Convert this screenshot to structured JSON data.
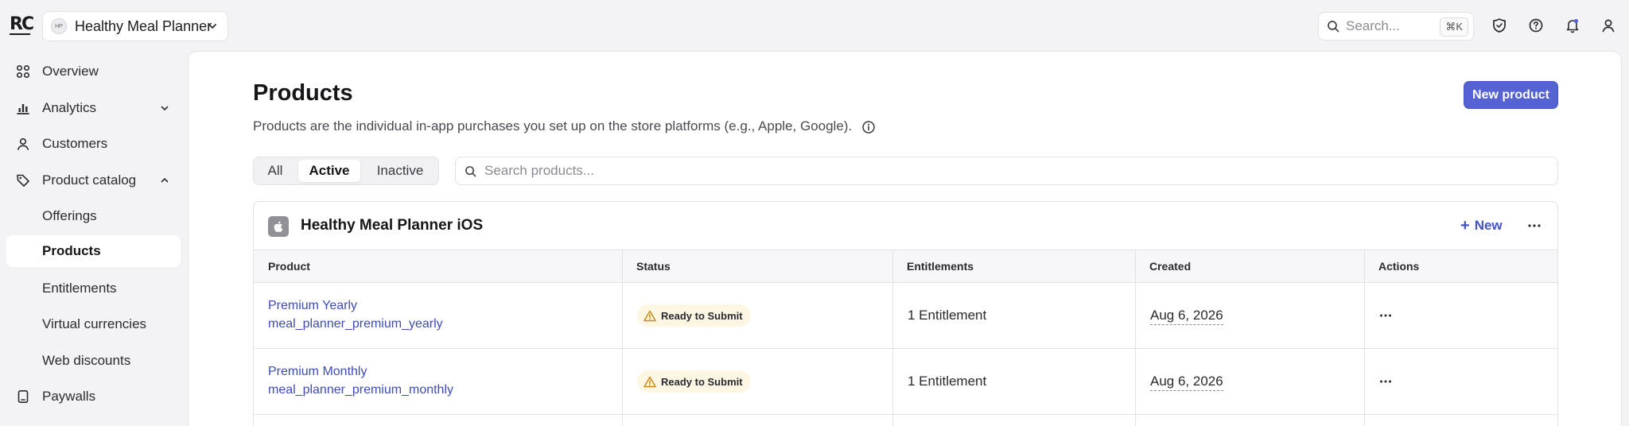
{
  "topbar": {
    "logo_text": "RC",
    "project_initials": "HP",
    "project_name": "Healthy Meal Planner",
    "search_placeholder": "Search...",
    "search_shortcut": "⌘K"
  },
  "sidebar": {
    "items": [
      {
        "label": "Overview",
        "icon": "grid-icon"
      },
      {
        "label": "Analytics",
        "icon": "bar-chart-icon",
        "expandable": true,
        "expanded": false
      },
      {
        "label": "Customers",
        "icon": "person-icon"
      },
      {
        "label": "Product catalog",
        "icon": "tag-icon",
        "expandable": true,
        "expanded": true
      },
      {
        "label": "Offerings"
      },
      {
        "label": "Products",
        "active": true
      },
      {
        "label": "Entitlements"
      },
      {
        "label": "Virtual currencies"
      },
      {
        "label": "Web discounts"
      },
      {
        "label": "Paywalls",
        "icon": "paywall-icon"
      }
    ]
  },
  "main": {
    "title": "Products",
    "description": "Products are the individual in-app purchases you set up on the store platforms (e.g., Apple, Google).",
    "new_product_label": "New product",
    "filter_tabs": [
      "All",
      "Active",
      "Inactive"
    ],
    "active_tab": "Active",
    "search_placeholder": "Search products..."
  },
  "app_card": {
    "app_name": "Healthy Meal Planner iOS",
    "new_label": "New",
    "columns": [
      "Product",
      "Status",
      "Entitlements",
      "Created",
      "Actions"
    ],
    "rows": [
      {
        "name": "Premium Yearly",
        "identifier": "meal_planner_premium_yearly",
        "status": "Ready to Submit",
        "entitlements": "1 Entitlement",
        "created": "Aug 6, 2026"
      },
      {
        "name": "Premium Monthly",
        "identifier": "meal_planner_premium_monthly",
        "status": "Ready to Submit",
        "entitlements": "1 Entitlement",
        "created": "Aug 6, 2026"
      }
    ]
  },
  "colors": {
    "accent": "#5563d2",
    "link": "#3d4bb8",
    "status_bg": "#fdf6e3",
    "warning_icon": "#c98a1a"
  }
}
